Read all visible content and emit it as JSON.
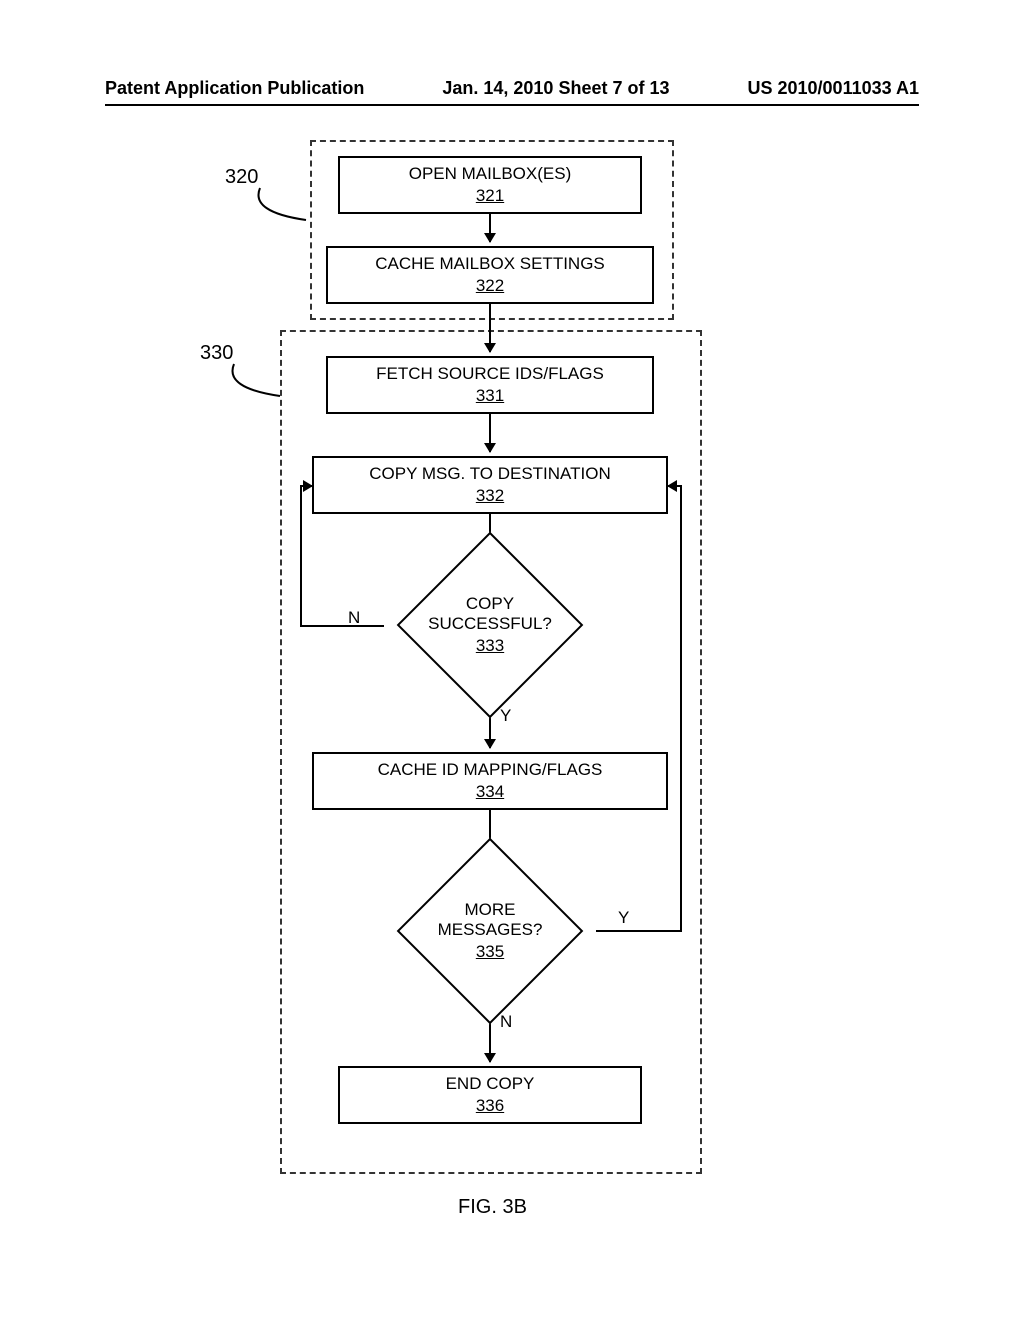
{
  "header": {
    "left": "Patent Application Publication",
    "center": "Jan. 14, 2010  Sheet 7 of 13",
    "right": "US 2010/0011033 A1"
  },
  "refs": {
    "r320": "320",
    "r330": "330"
  },
  "steps": {
    "s321": {
      "title": "OPEN MAILBOX(ES)",
      "num": "321"
    },
    "s322": {
      "title": "CACHE MAILBOX SETTINGS",
      "num": "322"
    },
    "s331": {
      "title": "FETCH SOURCE IDS/FLAGS",
      "num": "331"
    },
    "s332": {
      "title": "COPY MSG. TO DESTINATION",
      "num": "332"
    },
    "s333": {
      "title": "COPY SUCCESSFUL?",
      "num": "333"
    },
    "s334": {
      "title": "CACHE ID MAPPING/FLAGS",
      "num": "334"
    },
    "s335": {
      "title": "MORE MESSAGES?",
      "num": "335"
    },
    "s336": {
      "title": "END COPY",
      "num": "336"
    }
  },
  "yn": {
    "y": "Y",
    "n": "N"
  },
  "figure_caption": "FIG. 3B"
}
